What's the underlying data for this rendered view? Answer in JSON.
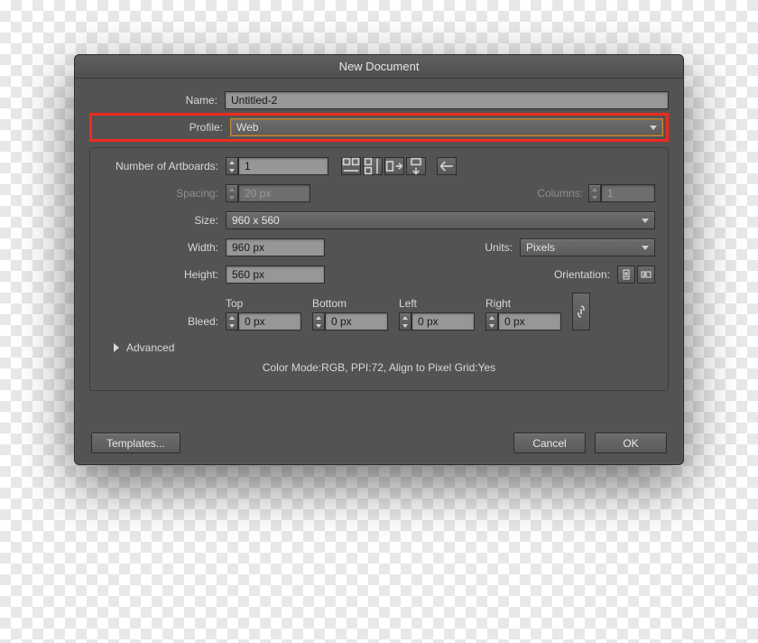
{
  "dialog": {
    "title": "New Document",
    "name_label": "Name:",
    "name_value": "Untitled-2",
    "profile_label": "Profile:",
    "profile_value": "Web",
    "artboards_label": "Number of Artboards:",
    "artboards_value": "1",
    "spacing_label": "Spacing:",
    "spacing_value": "20 px",
    "columns_label": "Columns:",
    "columns_value": "1",
    "size_label": "Size:",
    "size_value": "960 x 560",
    "width_label": "Width:",
    "width_value": "960 px",
    "units_label": "Units:",
    "units_value": "Pixels",
    "height_label": "Height:",
    "height_value": "560 px",
    "orientation_label": "Orientation:",
    "bleed_label": "Bleed:",
    "bleed": {
      "top_label": "Top",
      "top_value": "0 px",
      "bottom_label": "Bottom",
      "bottom_value": "0 px",
      "left_label": "Left",
      "left_value": "0 px",
      "right_label": "Right",
      "right_value": "0 px"
    },
    "advanced_label": "Advanced",
    "summary": "Color Mode:RGB, PPI:72, Align to Pixel Grid:Yes",
    "templates_btn": "Templates...",
    "cancel_btn": "Cancel",
    "ok_btn": "OK"
  }
}
